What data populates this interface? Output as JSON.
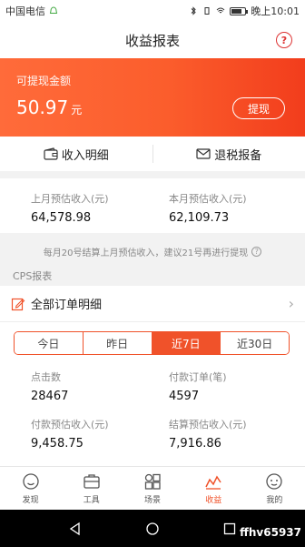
{
  "status_bar": {
    "carrier": "中国电信",
    "time": "晚上10:01"
  },
  "nav": {
    "title": "收益报表",
    "help": "?"
  },
  "banner": {
    "label": "可提现金额",
    "amount": "50.97",
    "unit": "元",
    "withdraw_label": "提现",
    "gradient": [
      "#ff6b3a",
      "#f23d1c"
    ]
  },
  "actions": [
    {
      "label": "收入明细",
      "icon": "wallet-icon"
    },
    {
      "label": "退税报备",
      "icon": "mail-icon"
    }
  ],
  "income_summary": [
    {
      "label": "上月预估收入(元)",
      "value": "64,578.98"
    },
    {
      "label": "本月预估收入(元)",
      "value": "62,109.73"
    }
  ],
  "notice": "每月20号结算上月预估收入，建议21号再进行提现",
  "section_label": "CPS报表",
  "orders_link": {
    "label": "全部订单明细",
    "icon": "edit-icon"
  },
  "period_tabs": [
    "今日",
    "昨日",
    "近7日",
    "近30日"
  ],
  "active_period": 2,
  "metrics": [
    {
      "label": "点击数",
      "value": "28467"
    },
    {
      "label": "付款订单(笔)",
      "value": "4597"
    },
    {
      "label": "付款预估收入(元)",
      "value": "9,458.75"
    },
    {
      "label": "结算预估收入(元)",
      "value": "7,916.86"
    }
  ],
  "tabbar": [
    {
      "label": "发现",
      "icon": "face-icon"
    },
    {
      "label": "工具",
      "icon": "toolbox-icon"
    },
    {
      "label": "场景",
      "icon": "grid-icon"
    },
    {
      "label": "收益",
      "icon": "chart-icon",
      "active": true
    },
    {
      "label": "我的",
      "icon": "profile-icon"
    }
  ],
  "watermark": "ffhv65937",
  "colors": {
    "accent": "#f0522a",
    "bg": "#f2f2f2"
  }
}
